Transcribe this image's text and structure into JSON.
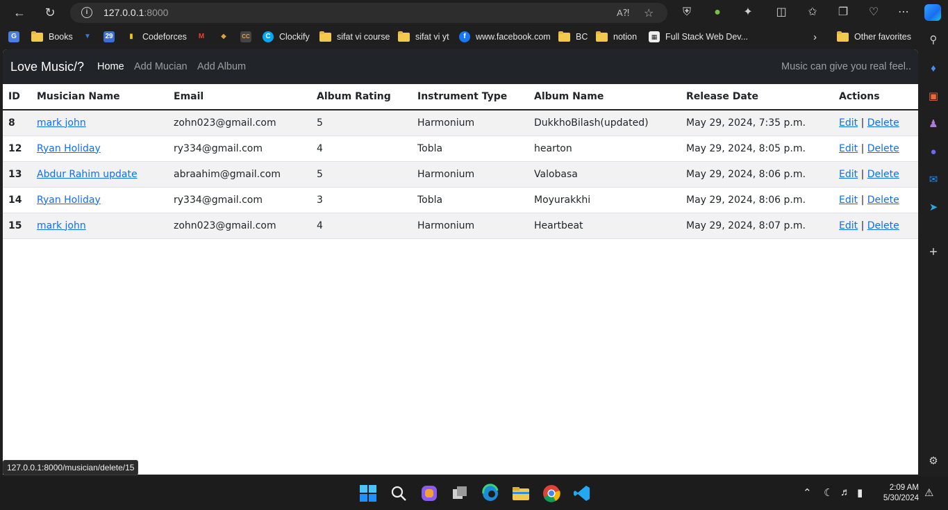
{
  "browser": {
    "url_host": "127.0.0.1",
    "url_port": ":8000",
    "bookmarks": [
      {
        "label": "Books",
        "type": "folder"
      },
      {
        "label": "Codeforces",
        "type": "site"
      },
      {
        "label": "Clockify",
        "type": "site"
      },
      {
        "label": "sifat vi course",
        "type": "folder"
      },
      {
        "label": "sifat vi yt",
        "type": "folder"
      },
      {
        "label": "www.facebook.com",
        "type": "site"
      },
      {
        "label": "BC",
        "type": "folder"
      },
      {
        "label": "notion",
        "type": "folder"
      },
      {
        "label": "Full Stack Web Dev...",
        "type": "site"
      }
    ],
    "other_favorites": "Other favorites",
    "status_url": "127.0.0.1:8000/musician/delete/15"
  },
  "app": {
    "brand": "Love Music/?",
    "nav": [
      "Home",
      "Add Mucian",
      "Add Album"
    ],
    "tagline": "Music can give you real feel..",
    "columns": [
      "ID",
      "Musician Name",
      "Email",
      "Album Rating",
      "Instrument Type",
      "Album Name",
      "Release Date",
      "Actions"
    ],
    "rows": [
      {
        "id": "8",
        "name": "mark john",
        "email": "zohn023@gmail.com",
        "rating": "5",
        "instrument": "Harmonium",
        "album": "DukkhoBilash(updated)",
        "date": "May 29, 2024, 7:35 p.m."
      },
      {
        "id": "12",
        "name": "Ryan Holiday",
        "email": "ry334@gmail.com",
        "rating": "4",
        "instrument": "Tobla",
        "album": "hearton",
        "date": "May 29, 2024, 8:05 p.m."
      },
      {
        "id": "13",
        "name": "Abdur Rahim update",
        "email": "abraahim@gmail.com",
        "rating": "5",
        "instrument": "Harmonium",
        "album": "Valobasa",
        "date": "May 29, 2024, 8:06 p.m."
      },
      {
        "id": "14",
        "name": "Ryan Holiday",
        "email": "ry334@gmail.com",
        "rating": "3",
        "instrument": "Tobla",
        "album": "Moyurakkhi",
        "date": "May 29, 2024, 8:06 p.m."
      },
      {
        "id": "15",
        "name": "mark john",
        "email": "zohn023@gmail.com",
        "rating": "4",
        "instrument": "Harmonium",
        "album": "Heartbeat",
        "date": "May 29, 2024, 8:07 p.m."
      }
    ],
    "edit_label": "Edit",
    "separator": "|",
    "delete_label": "Delete"
  },
  "taskbar": {
    "time": "2:09 AM",
    "date": "5/30/2024"
  }
}
